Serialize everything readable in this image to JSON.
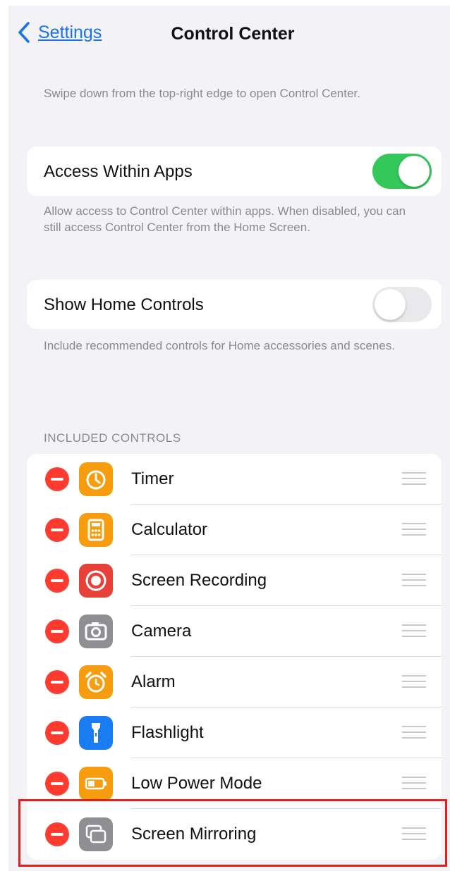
{
  "nav": {
    "back_label": "Settings",
    "title": "Control Center"
  },
  "intro_text": "Swipe down from the top-right edge to open Control Center.",
  "access_within_apps": {
    "label": "Access Within Apps",
    "enabled": true,
    "footer": "Allow access to Control Center within apps. When disabled, you can still access Control Center from the Home Screen."
  },
  "show_home_controls": {
    "label": "Show Home Controls",
    "enabled": false,
    "footer": "Include recommended controls for Home accessories and scenes."
  },
  "included_controls": {
    "header": "INCLUDED CONTROLS",
    "items": [
      {
        "label": "Timer",
        "icon": "timer-icon",
        "color": "#f59d0f"
      },
      {
        "label": "Calculator",
        "icon": "calculator-icon",
        "color": "#f59d0f"
      },
      {
        "label": "Screen Recording",
        "icon": "screen-recording-icon",
        "color": "#e8413a"
      },
      {
        "label": "Camera",
        "icon": "camera-icon",
        "color": "#8e8e93"
      },
      {
        "label": "Alarm",
        "icon": "alarm-icon",
        "color": "#f59d0f"
      },
      {
        "label": "Flashlight",
        "icon": "flashlight-icon",
        "color": "#1a7cf2"
      },
      {
        "label": "Low Power Mode",
        "icon": "low-power-icon",
        "color": "#f59d0f"
      },
      {
        "label": "Screen Mirroring",
        "icon": "screen-mirroring-icon",
        "color": "#8e8e93"
      }
    ]
  },
  "colors": {
    "toggle_on": "#34c759",
    "delete": "#ff3b30",
    "link": "#1a73e8",
    "highlight_box": "#e0221f"
  }
}
